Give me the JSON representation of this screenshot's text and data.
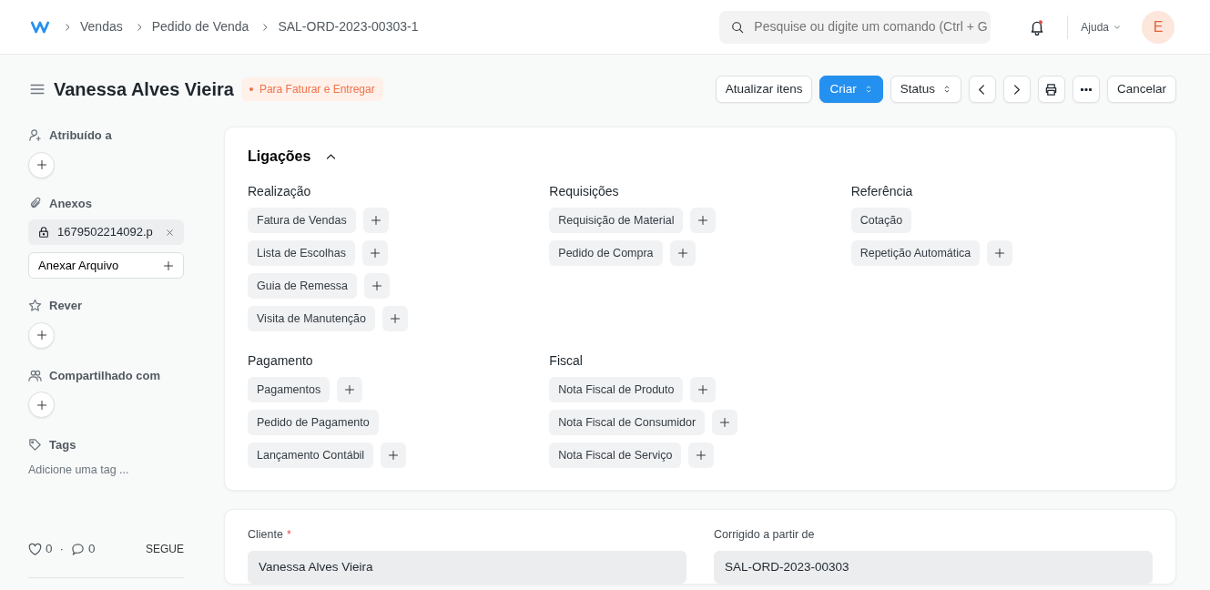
{
  "breadcrumbs": [
    "Vendas",
    "Pedido de Venda",
    "SAL-ORD-2023-00303-1"
  ],
  "search": {
    "placeholder": "Pesquise ou digite um comando (Ctrl + G"
  },
  "notifications": {
    "unread": true
  },
  "help": "Ajuda",
  "avatar": "E",
  "title": "Vanessa Alves Vieira",
  "status": "Para Faturar e Entregar",
  "actions": [
    {
      "label": "Atualizar itens",
      "kind": "plain"
    },
    {
      "label": "Criar",
      "kind": "primary-dropdown"
    },
    {
      "label": "Status",
      "kind": "dropdown"
    },
    {
      "kind": "prev"
    },
    {
      "kind": "next"
    },
    {
      "kind": "print"
    },
    {
      "kind": "more"
    },
    {
      "label": "Cancelar",
      "kind": "plain"
    }
  ],
  "sidebar": {
    "assigned": "Atribuído a",
    "attachments": "Anexos",
    "attachment_file": "1679502214092.p",
    "attach_button": "Anexar Arquivo",
    "review": "Rever",
    "shared": "Compartilhado com",
    "tags": "Tags",
    "tags_placeholder": "Adicione uma tag ...",
    "likes": "0",
    "separator": "·",
    "comments": "0",
    "follow": "SEGUE"
  },
  "links": {
    "title": "Ligações",
    "expanded": true,
    "groups": [
      {
        "title": "Realização",
        "items": [
          {
            "label": "Fatura de Vendas",
            "add": true
          },
          {
            "label": "Lista de Escolhas",
            "add": true
          },
          {
            "label": "Guia de Remessa",
            "add": true
          },
          {
            "label": "Visita de Manutenção",
            "add": true
          }
        ]
      },
      {
        "title": "Requisições",
        "items": [
          {
            "label": "Requisição de Material",
            "add": true
          },
          {
            "label": "Pedido de Compra",
            "add": true
          }
        ]
      },
      {
        "title": "Referência",
        "items": [
          {
            "label": "Cotação",
            "add": false
          },
          {
            "label": "Repetição Automática",
            "add": true
          }
        ]
      },
      {
        "title": "Pagamento",
        "items": [
          {
            "label": "Pagamentos",
            "add": true
          },
          {
            "label": "Pedido de Pagamento",
            "add": false
          },
          {
            "label": "Lançamento Contábil",
            "add": true
          }
        ]
      },
      {
        "title": "Fiscal",
        "items": [
          {
            "label": "Nota Fiscal de Produto",
            "add": true
          },
          {
            "label": "Nota Fiscal de Consumidor",
            "add": true
          },
          {
            "label": "Nota Fiscal de Serviço",
            "add": true
          }
        ]
      }
    ]
  },
  "fields": [
    {
      "label": "Cliente",
      "required_mark": "*",
      "value": "Vanessa Alves Vieira"
    },
    {
      "label": "Corrigido a partir de",
      "value": "SAL-ORD-2023-00303"
    }
  ]
}
